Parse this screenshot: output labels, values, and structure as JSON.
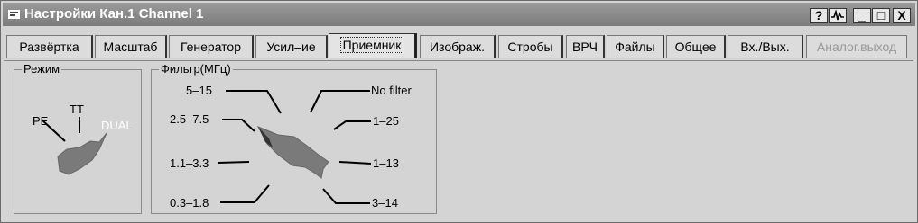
{
  "window": {
    "title": "Настройки Кан.1 Channel 1",
    "buttons": [
      "?",
      "Л",
      "_",
      "□",
      "X"
    ]
  },
  "tabs": [
    {
      "label": "Развёртка"
    },
    {
      "label": "Масштаб"
    },
    {
      "label": "Генератор"
    },
    {
      "label": "Усил–ие"
    },
    {
      "label": "Приемник",
      "active": true
    },
    {
      "label": "Изображ."
    },
    {
      "label": "Стробы"
    },
    {
      "label": "ВРЧ"
    },
    {
      "label": "Файлы"
    },
    {
      "label": "Общее"
    },
    {
      "label": "Вх./Вых."
    },
    {
      "label": "Аналог.выход",
      "disabled": true
    }
  ],
  "mode_group": {
    "title": "Режим",
    "options": [
      "PE",
      "TT",
      "DUAL"
    ],
    "selected": "DUAL"
  },
  "filter_group": {
    "title": "Фильтр(МГц)",
    "options": [
      "5–15",
      "2.5–7.5",
      "1.1–3.3",
      "0.3–1.8",
      "No filter",
      "1–25",
      "1–13",
      "3–14"
    ],
    "selected": "2.5–7.5"
  }
}
